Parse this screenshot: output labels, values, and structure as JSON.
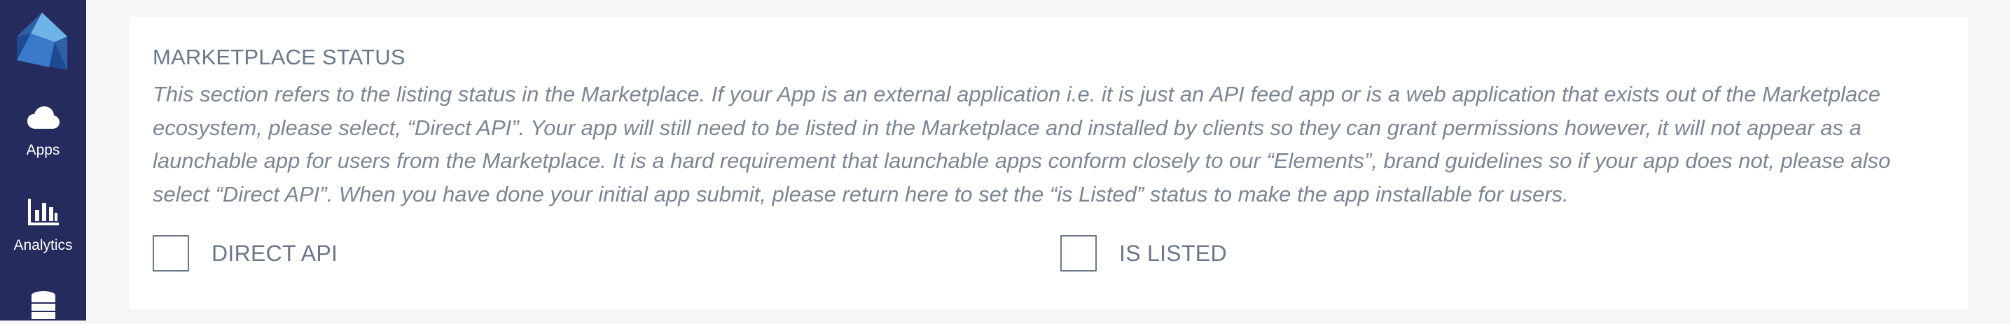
{
  "sidebar": {
    "logo_icon": "app-logo-icon",
    "items": [
      {
        "label": "Apps",
        "icon": "cloud-icon"
      },
      {
        "label": "Analytics",
        "icon": "bar-chart-icon"
      },
      {
        "label": "",
        "icon": "database-icon"
      }
    ]
  },
  "marketplace": {
    "title": "MARKETPLACE STATUS",
    "description": "This section refers to the listing status in the Marketplace. If your App is an external application i.e. it is just an API feed app or is a web application that exists out of the Marketplace ecosystem, please select, “Direct API”. Your app will still need to be listed in the Marketplace and installed by clients so they can grant permissions however, it will not appear as a launchable app for users from the Marketplace. It is a hard requirement that launchable apps conform closely to our “Elements”, brand guidelines so if your app does not, please also select “Direct API”. When you have done your initial app submit, please return here to set the “is Listed” status to make the app installable for users.",
    "options": [
      {
        "label": "DIRECT API",
        "checked": false
      },
      {
        "label": "IS LISTED",
        "checked": false
      }
    ]
  },
  "colors": {
    "sidebar_bg": "#262b5e",
    "page_bg": "#f5f6f8",
    "text_muted": "#6b7789"
  }
}
